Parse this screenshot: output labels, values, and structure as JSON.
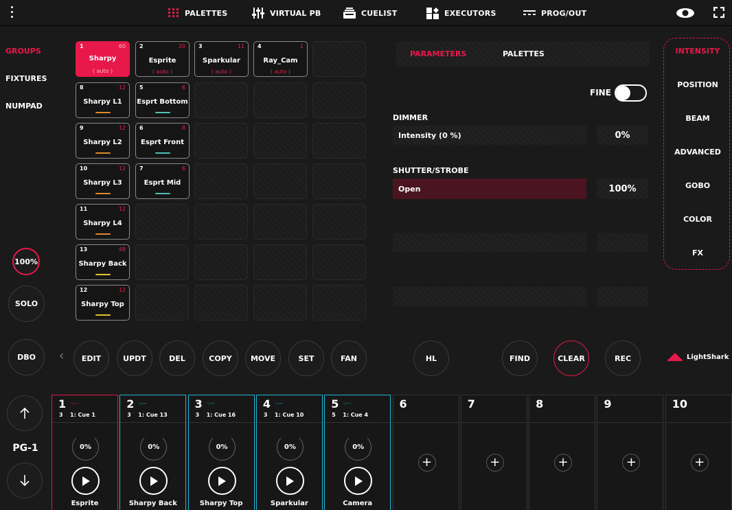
{
  "topbar": {
    "tabs": [
      {
        "label": "PALETTES",
        "icon": "grid-icon"
      },
      {
        "label": "VIRTUAL PB",
        "icon": "faders-icon"
      },
      {
        "label": "CUELIST",
        "icon": "cuelist-icon"
      },
      {
        "label": "EXECUTORS",
        "icon": "executors-icon"
      },
      {
        "label": "PROG/OUT",
        "icon": "prog-out-icon"
      }
    ],
    "accent": "#e8184a"
  },
  "sidebar": {
    "items": [
      "GROUPS",
      "FIXTURES",
      "NUMPAD"
    ],
    "level": "100%",
    "solo": "SOLO"
  },
  "groups": [
    {
      "num": "1",
      "count": "60",
      "name": "Sharpy",
      "sub": "( auto )",
      "selected": true
    },
    {
      "num": "2",
      "count": "20",
      "name": "Esprite",
      "sub": "( auto )"
    },
    {
      "num": "3",
      "count": "11",
      "name": "Sparkular",
      "sub": "( auto )"
    },
    {
      "num": "4",
      "count": "1",
      "name": "Ray_Cam",
      "sub": "( auto )"
    },
    {
      "num": "8",
      "count": "12",
      "name": "Sharpy L1",
      "bar": "#e08a2a"
    },
    {
      "num": "5",
      "count": "6",
      "name": "Esprt Bottom",
      "bar": "#4fc1b5"
    },
    {
      "num": "9",
      "count": "12",
      "name": "Sharpy L2",
      "bar": "#e08a2a"
    },
    {
      "num": "6",
      "count": "8",
      "name": "Esprt Front",
      "bar": "#4fc1b5"
    },
    {
      "num": "10",
      "count": "12",
      "name": "Sharpy L3",
      "bar": "#e08a2a"
    },
    {
      "num": "7",
      "count": "6",
      "name": "Esprt Mid",
      "bar": "#4fc1b5"
    },
    {
      "num": "11",
      "count": "12",
      "name": "Sharpy L4",
      "bar": "#e08a2a"
    },
    {
      "num": "13",
      "count": "48",
      "name": "Sharpy Back",
      "bar": "#e8c130"
    },
    {
      "num": "12",
      "count": "12",
      "name": "Sharpy Top",
      "bar": "#e8c130"
    }
  ],
  "params": {
    "tabs": [
      "PARAMETERS",
      "PALETTES"
    ],
    "fine_label": "FINE",
    "dimmer_title": "DIMMER",
    "dimmer_label": "Intensity (0 %)",
    "dimmer_value": "0%",
    "shutter_title": "SHUTTER/STROBE",
    "shutter_label": "Open",
    "shutter_value": "100%"
  },
  "attributes": [
    "INTENSITY",
    "POSITION",
    "BEAM",
    "ADVANCED",
    "GOBO",
    "COLOR",
    "FX"
  ],
  "actions": {
    "dbo": "DBO",
    "chevron": "‹",
    "buttons": [
      "EDIT",
      "UPDT",
      "DEL",
      "COPY",
      "MOVE",
      "SET",
      "FAN"
    ],
    "hl": "HL",
    "find": "FIND",
    "clear": "CLEAR",
    "rec": "REC",
    "brand": "LightShark"
  },
  "pager": {
    "label": "PG-1"
  },
  "executors": [
    {
      "num": "1",
      "dots": "·:---",
      "cues": "3",
      "cue": "1: Cue 1",
      "level": "0%",
      "name": "Esprite",
      "color": "#e8184a"
    },
    {
      "num": "2",
      "dots": "·:---",
      "cues": "3",
      "cue": "1: Cue 13",
      "level": "0%",
      "name": "Sharpy Back",
      "color": "#1db8d8"
    },
    {
      "num": "3",
      "dots": "·:---",
      "cues": "3",
      "cue": "1: Cue 16",
      "level": "0%",
      "name": "Sharpy Top",
      "color": "#1db8d8"
    },
    {
      "num": "4",
      "dots": "·:---",
      "cues": "3",
      "cue": "1: Cue 10",
      "level": "0%",
      "name": "Sparkular",
      "color": "#1db8d8"
    },
    {
      "num": "5",
      "dots": "·:---",
      "cues": "5",
      "cue": "1: Cue 4",
      "level": "0%",
      "name": "Camera",
      "color": "#1db8d8"
    },
    {
      "num": "6"
    },
    {
      "num": "7"
    },
    {
      "num": "8"
    },
    {
      "num": "9"
    },
    {
      "num": "10"
    }
  ],
  "plus": "+"
}
